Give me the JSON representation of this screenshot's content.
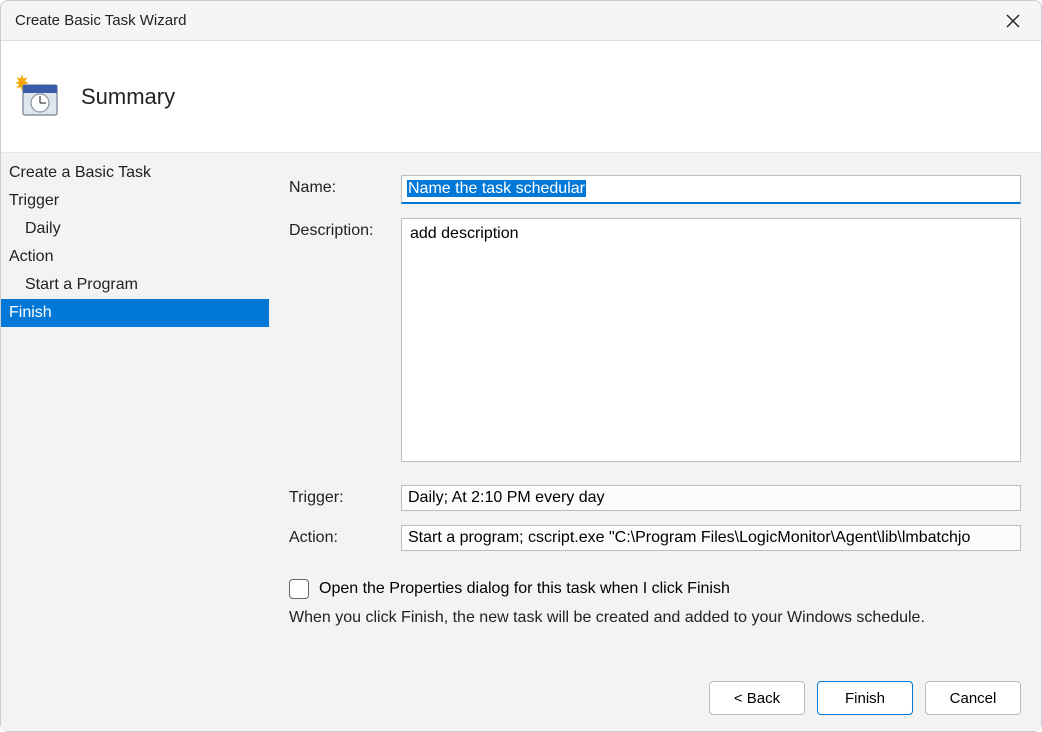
{
  "window": {
    "title": "Create Basic Task Wizard"
  },
  "header": {
    "title": "Summary"
  },
  "sidebar": {
    "items": [
      {
        "label": "Create a Basic Task",
        "indent": false,
        "selected": false
      },
      {
        "label": "Trigger",
        "indent": false,
        "selected": false
      },
      {
        "label": "Daily",
        "indent": true,
        "selected": false
      },
      {
        "label": "Action",
        "indent": false,
        "selected": false
      },
      {
        "label": "Start a Program",
        "indent": true,
        "selected": false
      },
      {
        "label": "Finish",
        "indent": false,
        "selected": true
      }
    ]
  },
  "form": {
    "name_label": "Name:",
    "name_value": "Name the task schedular",
    "desc_label": "Description:",
    "desc_value": "add description",
    "trigger_label": "Trigger:",
    "trigger_value": "Daily; At 2:10 PM every day",
    "action_label": "Action:",
    "action_value": "Start a program; cscript.exe \"C:\\Program Files\\LogicMonitor\\Agent\\lib\\lmbatchjo",
    "checkbox_label": "Open the Properties dialog for this task when I click Finish",
    "info_text": "When you click Finish, the new task will be created and added to your Windows schedule."
  },
  "buttons": {
    "back": "< Back",
    "finish": "Finish",
    "cancel": "Cancel"
  }
}
